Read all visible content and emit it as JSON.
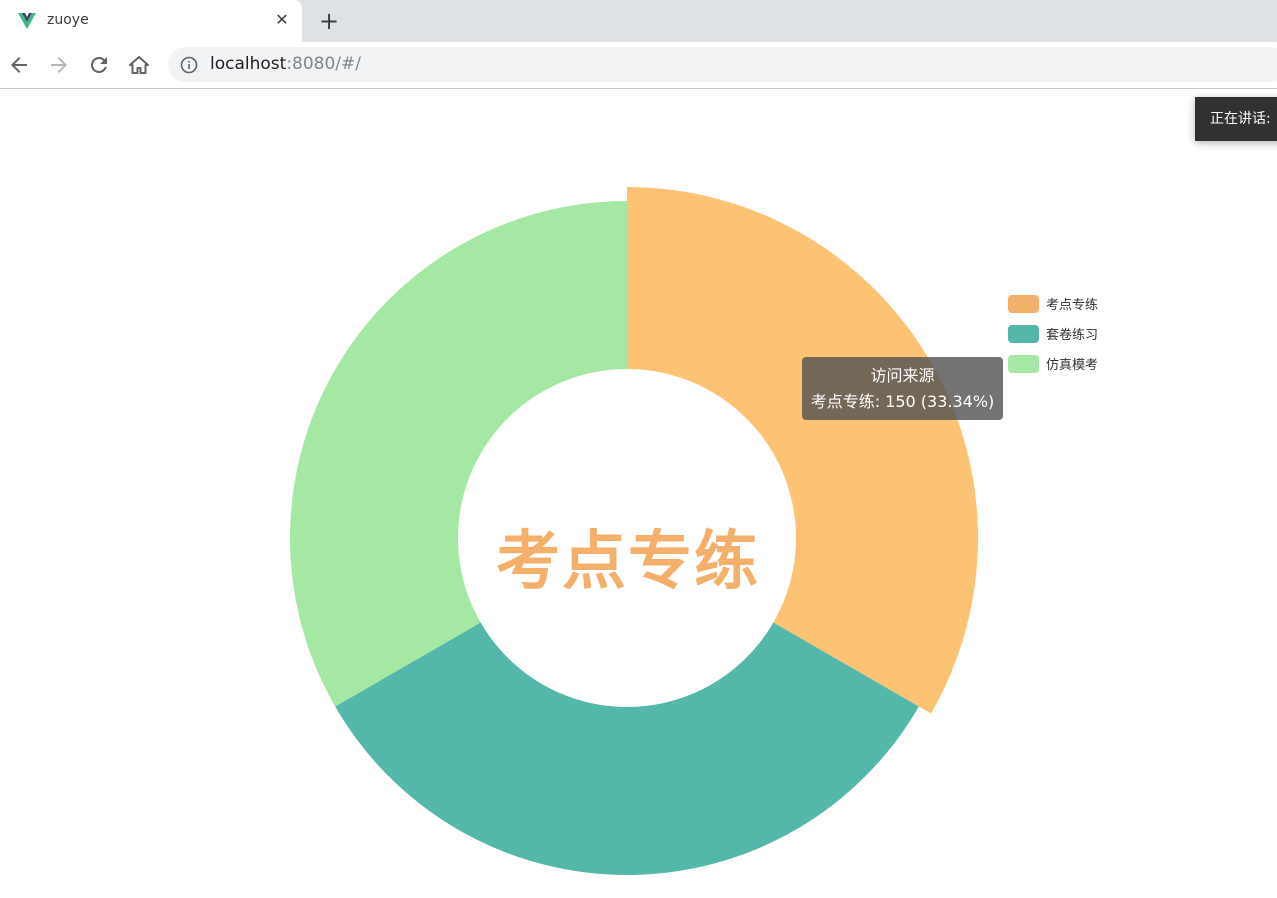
{
  "browser": {
    "tab_title": "zuoye",
    "url_host": "localhost",
    "url_rest": ":8080/#/"
  },
  "toast": {
    "text": "正在讲话:"
  },
  "chart_data": {
    "type": "pie",
    "variant": "donut",
    "series_name": "访问来源",
    "center_label": "考点专练",
    "categories": [
      "考点专练",
      "套卷练习",
      "仿真模考"
    ],
    "values": [
      150,
      150,
      150
    ],
    "colors": [
      "#fdc374",
      "#53b8a9",
      "#a5e8a4"
    ],
    "legend_colors": [
      "#f4b06a",
      "#53b8a9",
      "#a5e8a4"
    ],
    "highlighted_index": 0,
    "legend_placement": "right",
    "tooltip": {
      "title": "访问来源",
      "line": "考点专练: 150 (33.34%)"
    }
  }
}
